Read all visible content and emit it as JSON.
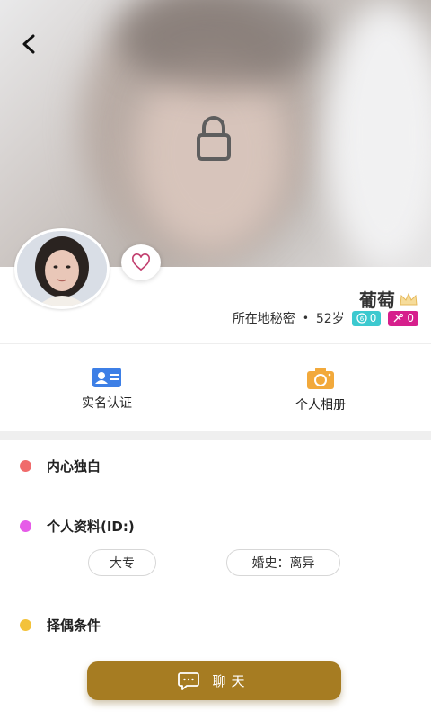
{
  "profile": {
    "name": "葡萄",
    "location": "所在地秘密",
    "separator": "•",
    "age": "52岁",
    "badge_cyan_value": "0",
    "badge_pink_value": "0"
  },
  "features": {
    "verify_label": "实名认证",
    "album_label": "个人相册"
  },
  "sections": {
    "monologue_title": "内心独白",
    "profile_title": "个人资料(ID:)",
    "criteria_title": "择偶条件"
  },
  "tags": {
    "education": "大专",
    "marital": "婚史：离异"
  },
  "chat": {
    "label": "聊天"
  },
  "colors": {
    "accent_gold": "#a67c22",
    "badge_cyan": "#3cc9cf",
    "badge_pink": "#d61f8c",
    "dot_red": "#f06b6b",
    "dot_pink": "#e65be8",
    "dot_yellow": "#f3c23a"
  },
  "icons": [
    "back-arrow-icon",
    "lock-icon",
    "heart-icon",
    "crown-icon",
    "id-card-icon",
    "camera-icon",
    "chat-bubble-icon"
  ]
}
